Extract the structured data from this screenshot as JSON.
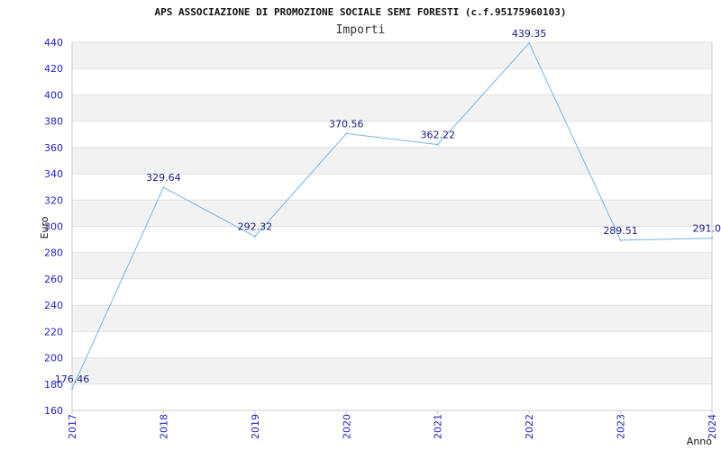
{
  "chart_data": {
    "type": "line",
    "title": "APS ASSOCIAZIONE DI PROMOZIONE SOCIALE SEMI FORESTI (c.f.95175960103)",
    "subtitle": "Importi",
    "xlabel": "Anno",
    "ylabel": "Euro",
    "categories": [
      "2017",
      "2018",
      "2019",
      "2020",
      "2021",
      "2022",
      "2023",
      "2024"
    ],
    "series": [
      {
        "values": [
          176.46,
          329.64,
          292.32,
          370.56,
          362.22,
          439.35,
          289.51,
          291.0
        ],
        "labels": [
          "176.46",
          "329.64",
          "292.32",
          "370.56",
          "362.22",
          "439.35",
          "289.51",
          "291.0"
        ]
      }
    ],
    "ylim": [
      160,
      440
    ],
    "yticks": [
      160,
      180,
      200,
      220,
      240,
      260,
      280,
      300,
      320,
      340,
      360,
      380,
      400,
      420,
      440
    ],
    "grid": true,
    "colors": {
      "line": "#78b4e8",
      "band_alt": "#f2f2f2",
      "band_base": "#ffffff",
      "tick_text": "#1f1fcf",
      "label_text": "#1a1a8a",
      "axis": "#cccccc"
    }
  }
}
